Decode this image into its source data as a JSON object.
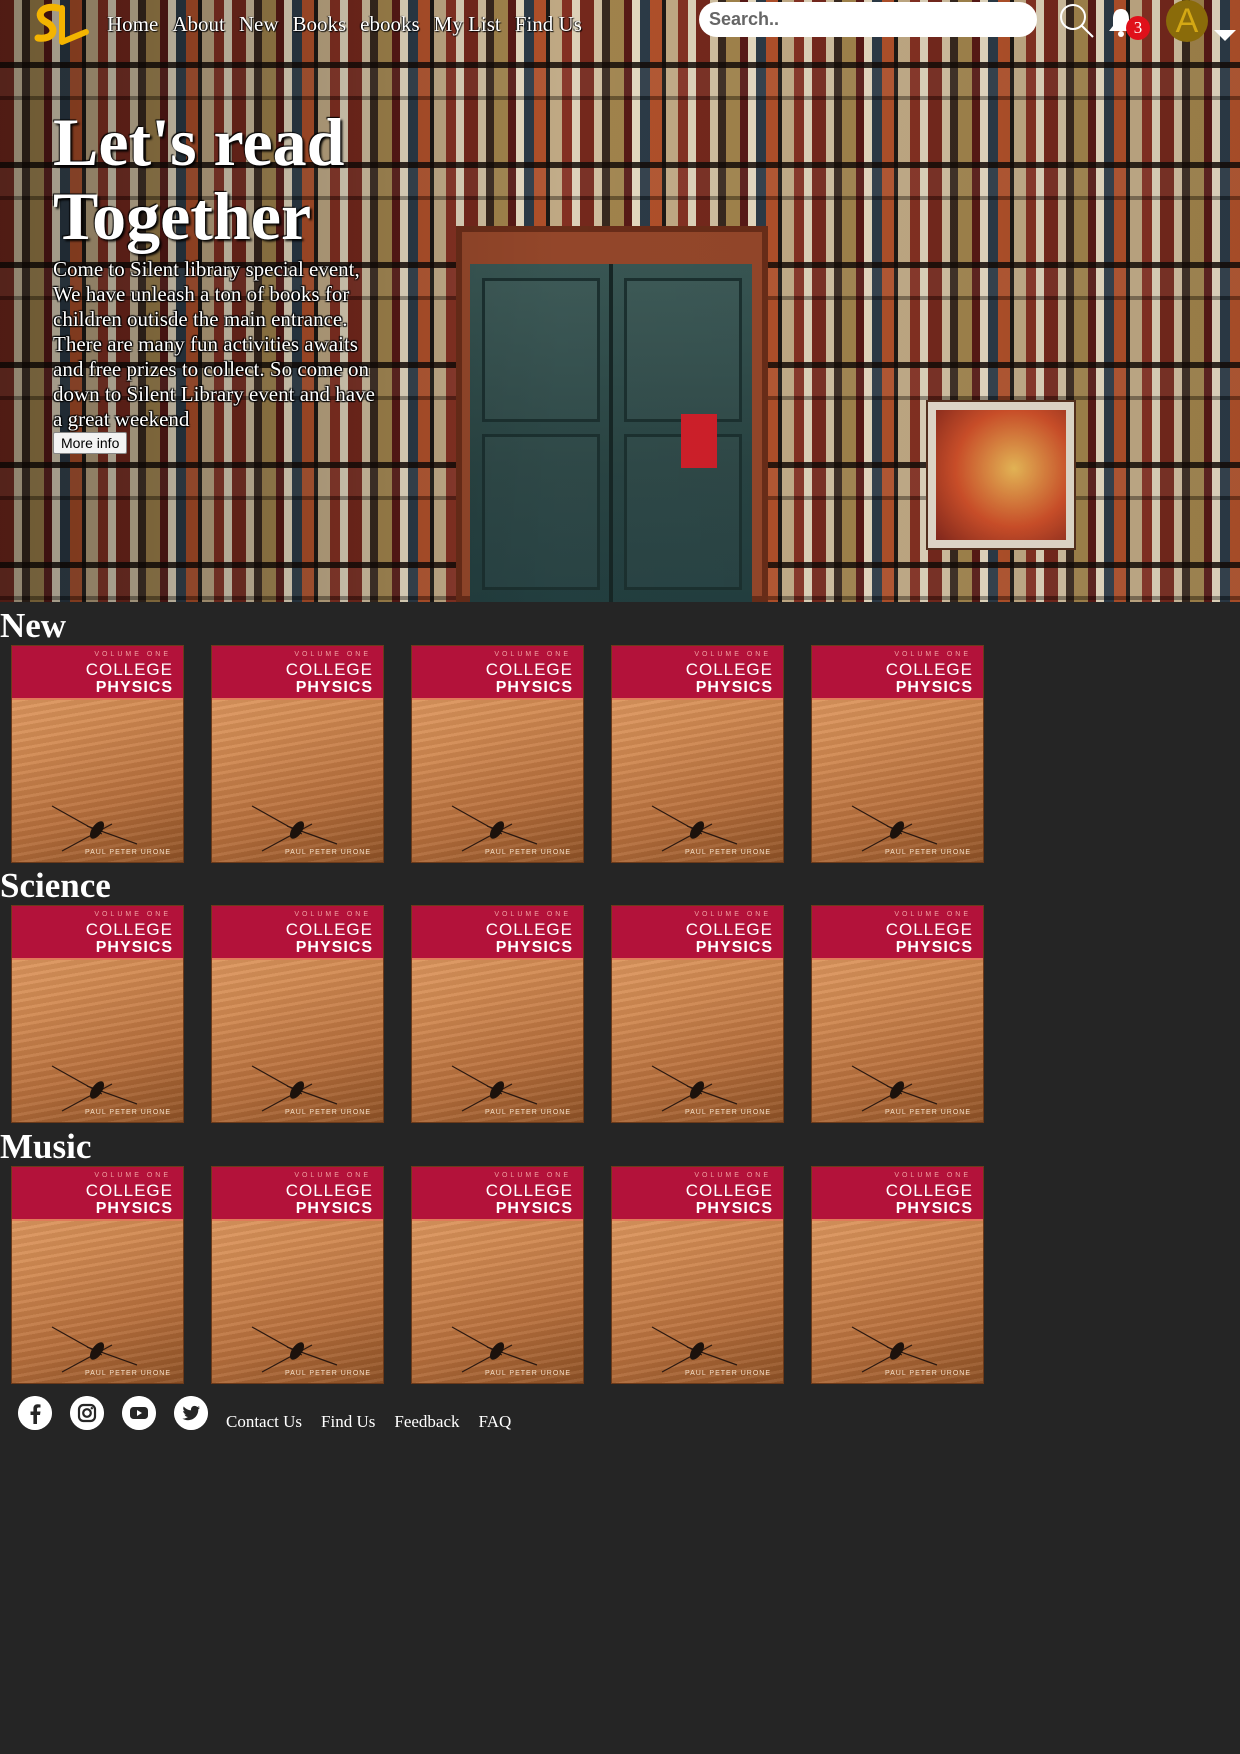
{
  "brand": {
    "logo_text": "SL",
    "logo_color": "#f4b400"
  },
  "nav": {
    "links": [
      "Home",
      "About",
      "New",
      "Books",
      "ebooks",
      "My List",
      "Find Us"
    ]
  },
  "search": {
    "placeholder": "Search..",
    "value": ""
  },
  "notifications": {
    "count": "3",
    "badge_color": "#e0101a"
  },
  "account": {
    "avatar_letter": "A"
  },
  "hero": {
    "title": "Let's read Together",
    "description": "Come to Silent library special event, We have unleash a ton of books for children outisde the main entrance. There are many fun activities awaits and free prizes to collect. So come on down to Silent Library event and have a great weekend",
    "button_label": "More info"
  },
  "book_cover": {
    "volume": "VOLUME ONE",
    "title_line1": "COLLEGE",
    "title_line2": "PHYSICS",
    "author": "PAUL PETER URONE"
  },
  "sections": [
    {
      "title": "New"
    },
    {
      "title": "Science"
    },
    {
      "title": "Music"
    }
  ],
  "footer": {
    "social": [
      "facebook-icon",
      "instagram-icon",
      "youtube-icon",
      "twitter-icon"
    ],
    "links": [
      "Contact Us",
      "Find Us",
      "Feedback",
      "FAQ"
    ]
  },
  "colors": {
    "background": "#252525",
    "book_band": "#b3123a"
  }
}
